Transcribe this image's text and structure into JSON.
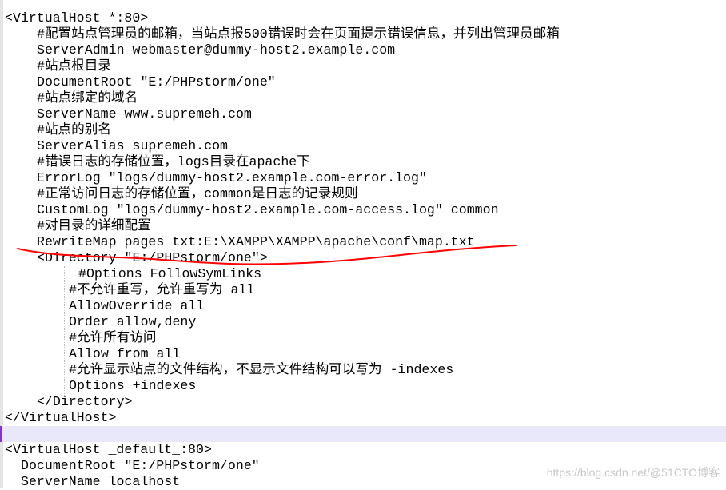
{
  "editor": {
    "lines": [
      {
        "indent": 0,
        "text": "<VirtualHost *:80>"
      },
      {
        "indent": 4,
        "text": "#配置站点管理员的邮箱，当站点报500错误时会在页面提示错误信息，并列出管理员邮箱"
      },
      {
        "indent": 4,
        "text": "ServerAdmin webmaster@dummy-host2.example.com"
      },
      {
        "indent": 4,
        "text": "#站点根目录"
      },
      {
        "indent": 4,
        "text": "DocumentRoot \"E:/PHPstorm/one\""
      },
      {
        "indent": 4,
        "text": "#站点绑定的域名"
      },
      {
        "indent": 4,
        "text": "ServerName www.supremeh.com"
      },
      {
        "indent": 4,
        "text": "#站点的别名"
      },
      {
        "indent": 4,
        "text": "ServerAlias supremeh.com"
      },
      {
        "indent": 4,
        "text": "#错误日志的存储位置，logs目录在apache下"
      },
      {
        "indent": 4,
        "text": "ErrorLog \"logs/dummy-host2.example.com-error.log\""
      },
      {
        "indent": 4,
        "text": "#正常访问日志的存储位置，common是日志的记录规则"
      },
      {
        "indent": 4,
        "text": "CustomLog \"logs/dummy-host2.example.com-access.log\" common"
      },
      {
        "indent": 4,
        "text": "#对目录的详细配置"
      },
      {
        "indent": 4,
        "text": "RewriteMap pages txt:E:\\XAMPP\\XAMPP\\apache\\conf\\map.txt"
      },
      {
        "indent": 4,
        "text": "<Directory \"E:/PHPstorm/one\">"
      },
      {
        "indent": 9.2,
        "text": "#Options FollowSymLinks"
      },
      {
        "indent": 8,
        "text": "#不允许重写，允许重写为 all"
      },
      {
        "indent": 8,
        "text": "AllowOverride all"
      },
      {
        "indent": 8,
        "text": "Order allow,deny"
      },
      {
        "indent": 8,
        "text": "#允许所有访问"
      },
      {
        "indent": 8,
        "text": "Allow from all"
      },
      {
        "indent": 8,
        "text": "#允许显示站点的文件结构，不显示文件结构可以写为 -indexes"
      },
      {
        "indent": 8,
        "text": "Options +indexes"
      },
      {
        "indent": 4,
        "text": "</Directory>"
      },
      {
        "indent": 0,
        "text": "</VirtualHost>"
      },
      {
        "indent": 0,
        "text": "",
        "current": true
      },
      {
        "indent": 0,
        "text": "<VirtualHost _default_:80>"
      },
      {
        "indent": 2,
        "text": "DocumentRoot \"E:/PHPstorm/one\""
      },
      {
        "indent": 2,
        "text": "ServerName localhost"
      }
    ]
  },
  "annotation_color": "#ff0000",
  "highlight_color": "#e8e8fa",
  "watermark": "https://blog.csdn.net/@51CTO博客"
}
